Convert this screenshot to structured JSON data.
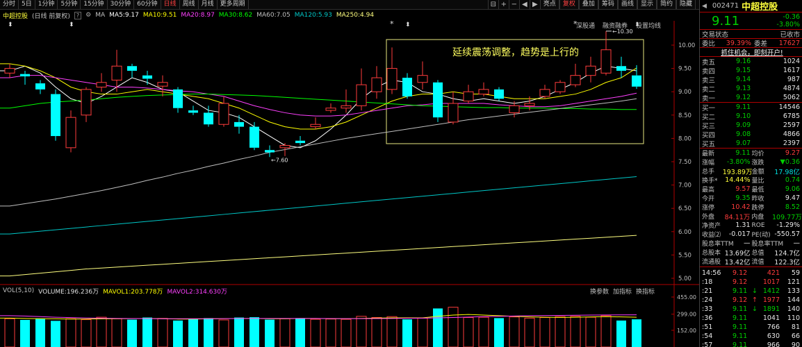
{
  "toolbar": {
    "left": [
      "分时",
      "5日",
      "1分钟",
      "5分钟",
      "15分钟",
      "30分钟",
      "60分钟",
      "日线",
      "周线",
      "月线",
      "更多周期"
    ],
    "active": "日线",
    "right": [
      "亮点",
      "复权",
      "叠加",
      "筹码",
      "画线",
      "显示",
      "简约",
      "隐藏"
    ],
    "active_right": "复权"
  },
  "info": {
    "name": "中超控股",
    "mode": "(日线 前复权)",
    "ma_label": "MA",
    "ma": [
      {
        "text": "MA5:9.17",
        "color": "#ffffff"
      },
      {
        "text": "MA10:9.51",
        "color": "#ffff00"
      },
      {
        "text": "MA20:8.97",
        "color": "#ff40ff"
      },
      {
        "text": "MA30:8.62",
        "color": "#00ff00"
      },
      {
        "text": "MA60:7.05",
        "color": "#c0c0c0"
      },
      {
        "text": "MA120:5.93",
        "color": "#00c8c8"
      },
      {
        "text": "MA250:4.94",
        "color": "#ffff80"
      }
    ],
    "sub_links": [
      "深股通",
      "融资融券",
      "设置均线"
    ]
  },
  "annotation": "延续震荡调整，趋势是上行的",
  "markers": {
    "high": "10.30",
    "low": "7.60",
    "star": "*"
  },
  "vol": {
    "label": "VOL(5,10)",
    "items": [
      {
        "text": "VOLUME:196.236万",
        "color": "#e0e0e0"
      },
      {
        "text": "MAVOL1:203.778万",
        "color": "#ffff00"
      },
      {
        "text": "MAVOL2:314.630万",
        "color": "#ff40ff"
      }
    ],
    "tools": [
      "换参数",
      "加指标",
      "换指标"
    ]
  },
  "chart_data": {
    "type": "candlestick",
    "y_ticks": [
      "10.00",
      "9.50",
      "9.00",
      "8.50",
      "8.00",
      "7.50",
      "7.00",
      "6.50",
      "6.00",
      "5.50",
      "5.00"
    ],
    "vol_ticks": [
      "455.00",
      "299.00",
      "152.00"
    ],
    "candles": [
      {
        "o": 9.4,
        "c": 9.5,
        "h": 9.6,
        "l": 9.3
      },
      {
        "o": 9.38,
        "c": 9.33,
        "h": 9.45,
        "l": 9.15
      },
      {
        "o": 9.18,
        "c": 9.05,
        "h": 9.25,
        "l": 8.95
      },
      {
        "o": 8.95,
        "c": 8.05,
        "h": 9.05,
        "l": 7.95
      },
      {
        "o": 7.8,
        "c": 8.45,
        "h": 8.6,
        "l": 7.7
      },
      {
        "o": 8.5,
        "c": 9.05,
        "h": 9.1,
        "l": 8.35
      },
      {
        "o": 9.1,
        "c": 9.2,
        "h": 9.4,
        "l": 9.0
      },
      {
        "o": 9.25,
        "c": 9.55,
        "h": 9.9,
        "l": 9.0
      },
      {
        "o": 9.55,
        "c": 9.45,
        "h": 9.6,
        "l": 9.3
      },
      {
        "o": 9.35,
        "c": 9.28,
        "h": 9.45,
        "l": 9.15
      },
      {
        "o": 9.12,
        "c": 9.2,
        "h": 9.35,
        "l": 8.9
      },
      {
        "o": 9.05,
        "c": 8.65,
        "h": 9.1,
        "l": 8.55
      },
      {
        "o": 8.6,
        "c": 8.55,
        "h": 8.7,
        "l": 8.5
      },
      {
        "o": 8.55,
        "c": 8.3,
        "h": 8.7,
        "l": 8.25
      },
      {
        "o": 8.3,
        "c": 8.75,
        "h": 8.9,
        "l": 8.25
      },
      {
        "o": 8.35,
        "c": 8.25,
        "h": 8.5,
        "l": 8.1
      },
      {
        "o": 8.25,
        "c": 7.8,
        "h": 8.35,
        "l": 7.75
      },
      {
        "o": 7.75,
        "c": 7.7,
        "h": 7.85,
        "l": 7.6
      },
      {
        "o": 7.8,
        "c": 7.85,
        "h": 7.9,
        "l": 7.62
      },
      {
        "o": 7.95,
        "c": 7.9,
        "h": 8.05,
        "l": 7.85
      },
      {
        "o": 8.25,
        "c": 8.3,
        "h": 8.45,
        "l": 8.2
      },
      {
        "o": 8.6,
        "c": 8.65,
        "h": 8.75,
        "l": 8.55
      },
      {
        "o": 8.65,
        "c": 8.7,
        "h": 9.05,
        "l": 8.55
      },
      {
        "o": 8.7,
        "c": 9.15,
        "h": 9.5,
        "l": 8.6
      },
      {
        "o": 9.0,
        "c": 9.3,
        "h": 9.55,
        "l": 8.85
      },
      {
        "o": 9.05,
        "c": 9.5,
        "h": 9.95,
        "l": 8.95
      },
      {
        "o": 9.3,
        "c": 8.9,
        "h": 9.4,
        "l": 8.85
      },
      {
        "o": 9.2,
        "c": 9.35,
        "h": 9.65,
        "l": 9.05
      },
      {
        "o": 9.2,
        "c": 8.45,
        "h": 9.25,
        "l": 8.35
      },
      {
        "o": 8.35,
        "c": 8.75,
        "h": 9.0,
        "l": 8.3
      },
      {
        "o": 8.8,
        "c": 9.0,
        "h": 9.15,
        "l": 8.75
      },
      {
        "o": 8.95,
        "c": 9.05,
        "h": 9.2,
        "l": 8.9
      },
      {
        "o": 9.05,
        "c": 8.85,
        "h": 9.1,
        "l": 8.8
      },
      {
        "o": 8.55,
        "c": 8.7,
        "h": 8.8,
        "l": 8.45
      },
      {
        "o": 8.7,
        "c": 8.75,
        "h": 8.9,
        "l": 8.6
      },
      {
        "o": 8.9,
        "c": 9.05,
        "h": 9.15,
        "l": 8.85
      },
      {
        "o": 9.0,
        "c": 9.2,
        "h": 9.25,
        "l": 8.95
      },
      {
        "o": 9.15,
        "c": 9.35,
        "h": 9.6,
        "l": 9.1
      },
      {
        "o": 9.35,
        "c": 9.55,
        "h": 9.75,
        "l": 9.2
      },
      {
        "o": 9.4,
        "c": 9.9,
        "h": 10.3,
        "l": 9.35
      },
      {
        "o": 9.55,
        "c": 9.45,
        "h": 9.75,
        "l": 9.3
      },
      {
        "o": 9.35,
        "c": 9.11,
        "h": 9.57,
        "l": 9.06
      }
    ],
    "volumes": [
      250,
      230,
      255,
      215,
      250,
      235,
      275,
      250,
      235,
      270,
      255,
      220,
      250,
      260,
      230,
      270,
      275,
      235,
      250,
      260,
      240,
      245,
      240,
      290,
      270,
      285,
      240,
      260,
      420,
      440,
      270,
      275,
      260,
      280,
      260,
      270,
      285,
      290,
      275,
      300,
      220,
      240
    ],
    "ma_lines": [
      {
        "name": "MA5",
        "color": "#ffffff",
        "pts": [
          9.45,
          9.55,
          9.4,
          9.1,
          8.85,
          8.75,
          8.9,
          9.1,
          9.3,
          9.2,
          9.05,
          9.0,
          8.8,
          8.6,
          8.55,
          8.45,
          8.25,
          8.05,
          7.85,
          7.8,
          7.95,
          8.2,
          8.5,
          8.85,
          9.1,
          9.25,
          9.2,
          9.0,
          8.95,
          8.85,
          8.8,
          8.85,
          8.8,
          8.75,
          8.8,
          8.9,
          9.05,
          9.2,
          9.4,
          9.55,
          9.5,
          9.45
        ]
      },
      {
        "name": "MA10",
        "color": "#ffff00",
        "pts": [
          9.6,
          9.55,
          9.45,
          9.3,
          9.1,
          9.0,
          8.95,
          8.95,
          9.0,
          9.05,
          9.0,
          8.95,
          8.9,
          8.85,
          8.75,
          8.65,
          8.5,
          8.35,
          8.25,
          8.2,
          8.2,
          8.25,
          8.35,
          8.5,
          8.65,
          8.8,
          8.9,
          8.95,
          8.95,
          9.0,
          8.95,
          8.95,
          8.9,
          8.85,
          8.85,
          8.85,
          8.9,
          8.95,
          9.05,
          9.2,
          9.3,
          9.51
        ]
      },
      {
        "name": "MA20",
        "color": "#ff40ff",
        "pts": [
          9.3,
          9.35,
          9.35,
          9.3,
          9.25,
          9.2,
          9.15,
          9.1,
          9.1,
          9.08,
          9.05,
          9.02,
          9.0,
          8.95,
          8.9,
          8.8,
          8.7,
          8.62,
          8.55,
          8.5,
          8.48,
          8.48,
          8.5,
          8.55,
          8.6,
          8.65,
          8.7,
          8.72,
          8.75,
          8.75,
          8.75,
          8.75,
          8.72,
          8.7,
          8.68,
          8.68,
          8.7,
          8.75,
          8.8,
          8.85,
          8.9,
          8.97
        ]
      },
      {
        "name": "MA30",
        "color": "#00ff00",
        "pts": [
          8.65,
          8.7,
          8.75,
          8.78,
          8.8,
          8.82,
          8.85,
          8.88,
          8.9,
          8.92,
          8.93,
          8.94,
          8.95,
          8.95,
          8.94,
          8.93,
          8.92,
          8.9,
          8.88,
          8.86,
          8.84,
          8.82,
          8.8,
          8.78,
          8.76,
          8.74,
          8.72,
          8.7,
          8.69,
          8.68,
          8.67,
          8.66,
          8.66,
          8.65,
          8.65,
          8.65,
          8.64,
          8.64,
          8.63,
          8.63,
          8.62,
          8.62
        ]
      },
      {
        "name": "MA60",
        "color": "#c0c0c0",
        "pts": [
          6.55,
          6.6,
          6.65,
          6.7,
          6.76,
          6.82,
          6.88,
          6.95,
          7.02,
          7.1,
          7.17,
          7.25,
          7.32,
          7.4,
          7.47,
          7.55,
          7.62,
          7.7,
          7.76,
          7.82,
          7.88,
          7.94,
          8.0,
          8.05,
          8.1,
          8.15,
          8.2,
          8.25,
          8.3,
          8.35,
          8.4,
          8.44,
          8.48,
          8.52,
          8.56,
          8.6,
          8.64,
          8.68,
          8.72,
          8.76,
          8.8,
          8.85
        ]
      },
      {
        "name": "MA120",
        "color": "#00c8c8",
        "pts": [
          5.95,
          5.98,
          6.01,
          6.04,
          6.07,
          6.1,
          6.13,
          6.16,
          6.19,
          6.22,
          6.25,
          6.28,
          6.31,
          6.34,
          6.37,
          6.4,
          6.43,
          6.46,
          6.49,
          6.52,
          6.55,
          6.58,
          6.61,
          6.64,
          6.67,
          6.7,
          6.73,
          6.76,
          6.79,
          6.82,
          6.85,
          6.88,
          6.91,
          6.94,
          6.97,
          7.0,
          7.03,
          7.06,
          7.09,
          7.12,
          7.15,
          7.18
        ]
      },
      {
        "name": "MA250",
        "color": "#ffff80",
        "pts": [
          5.05,
          5.08,
          5.11,
          5.14,
          5.17,
          5.2,
          5.22,
          5.24,
          5.26,
          5.28,
          5.3,
          5.32,
          5.34,
          5.36,
          5.38,
          5.4,
          5.42,
          5.44,
          5.46,
          5.48,
          5.5,
          5.52,
          5.54,
          5.56,
          5.58,
          5.6,
          5.62,
          5.64,
          5.66,
          5.68,
          5.7,
          5.72,
          5.74,
          5.76,
          5.78,
          5.8,
          5.82,
          5.84,
          5.86,
          5.88,
          5.9,
          5.92
        ]
      }
    ],
    "mavol1": [
      260,
      255,
      250,
      248,
      245,
      245,
      248,
      250,
      252,
      255,
      250,
      245,
      245,
      248,
      252,
      255,
      255,
      250,
      250,
      255,
      255,
      250,
      250,
      255,
      260,
      265,
      265,
      265,
      290,
      310,
      320,
      310,
      300,
      290,
      280,
      275,
      272,
      275,
      280,
      285,
      280,
      275
    ],
    "mavol2": [
      300,
      295,
      285,
      275,
      268,
      262,
      258,
      255,
      253,
      252,
      250,
      250,
      250,
      250,
      252,
      253,
      255,
      255,
      255,
      255,
      254,
      253,
      252,
      252,
      253,
      255,
      258,
      260,
      265,
      270,
      278,
      285,
      290,
      295,
      300,
      302,
      305,
      308,
      310,
      312,
      313,
      315
    ]
  },
  "panel": {
    "code": "002471",
    "name": "中超控股",
    "price": "9.11",
    "change": "-0.36",
    "change_pct": "-3.80%",
    "status_label": "交易状态",
    "status": "已收市",
    "wb_label": "委比",
    "wb": "39.39%",
    "wc_label": "委差",
    "wc": "17627",
    "promo": "抓住机会，即刻开户!",
    "sells": [
      {
        "label": "卖五",
        "price": "9.16",
        "vol": "1024"
      },
      {
        "label": "卖四",
        "price": "9.15",
        "vol": "1617"
      },
      {
        "label": "卖三",
        "price": "9.14",
        "vol": "987"
      },
      {
        "label": "卖二",
        "price": "9.13",
        "vol": "4874"
      },
      {
        "label": "卖一",
        "price": "9.12",
        "vol": "5062"
      }
    ],
    "buys": [
      {
        "label": "买一",
        "price": "9.11",
        "vol": "14546"
      },
      {
        "label": "买二",
        "price": "9.10",
        "vol": "6785"
      },
      {
        "label": "买三",
        "price": "9.09",
        "vol": "2597"
      },
      {
        "label": "买四",
        "price": "9.08",
        "vol": "4866"
      },
      {
        "label": "买五",
        "price": "9.07",
        "vol": "2397"
      }
    ],
    "stats": [
      [
        {
          "l": "最新",
          "v": "9.11",
          "c": "grn"
        },
        {
          "l": "均价",
          "v": "9.27",
          "c": "red"
        }
      ],
      [
        {
          "l": "涨幅",
          "v": "-3.80%",
          "c": "grn"
        },
        {
          "l": "涨跌",
          "v": "▼0.36",
          "c": "grn"
        }
      ],
      [
        {
          "l": "总手",
          "v": "193.89万",
          "c": "yel"
        },
        {
          "l": "金额",
          "v": "17.98亿",
          "c": "cyan"
        }
      ],
      [
        {
          "l": "换手*",
          "v": "14.44%",
          "c": "yel"
        },
        {
          "l": "量比",
          "v": "0.74",
          "c": "grn"
        }
      ],
      [
        {
          "l": "最高",
          "v": "9.57",
          "c": "red"
        },
        {
          "l": "最低",
          "v": "9.06",
          "c": "grn"
        }
      ],
      [
        {
          "l": "今开",
          "v": "9.35",
          "c": "grn"
        },
        {
          "l": "昨收",
          "v": "9.47",
          "c": "wht"
        }
      ],
      [
        {
          "l": "涨停",
          "v": "10.42",
          "c": "red"
        },
        {
          "l": "跌停",
          "v": "8.52",
          "c": "grn"
        }
      ],
      [
        {
          "l": "外盘",
          "v": "84.11万",
          "c": "red"
        },
        {
          "l": "内盘",
          "v": "109.77万",
          "c": "grn"
        }
      ],
      [
        {
          "l": "净资产",
          "v": "1.31",
          "c": "wht"
        },
        {
          "l": "ROE",
          "v": "-1.29%",
          "c": "wht"
        }
      ],
      [
        {
          "l": "收益⑵",
          "v": "-0.017",
          "c": "wht"
        },
        {
          "l": "PE(动)",
          "v": "-550.57",
          "c": "wht"
        }
      ],
      [
        {
          "l": "股息率TTM",
          "v": "—",
          "c": "wht"
        },
        {
          "l": "股息率TTM",
          "v": "—",
          "c": "wht"
        }
      ],
      [
        {
          "l": "总股本",
          "v": "13.69亿",
          "c": "wht"
        },
        {
          "l": "总值",
          "v": "124.7亿",
          "c": "wht"
        }
      ],
      [
        {
          "l": "流通股",
          "v": "13.42亿",
          "c": "wht"
        },
        {
          "l": "流值",
          "v": "122.3亿",
          "c": "wht"
        }
      ]
    ],
    "ticks": [
      {
        "t": "14:56",
        "p": "9.12",
        "pc": "red",
        "a": "",
        "v": "421",
        "vc": "red",
        "n": "59"
      },
      {
        "t": ":18",
        "p": "9.12",
        "pc": "red",
        "a": "",
        "v": "1017",
        "vc": "red",
        "n": "121"
      },
      {
        "t": ":21",
        "p": "9.11",
        "pc": "grn",
        "a": "↓",
        "v": "1412",
        "vc": "grn",
        "n": "133"
      },
      {
        "t": ":24",
        "p": "9.12",
        "pc": "red",
        "a": "↑",
        "v": "1977",
        "vc": "red",
        "n": "144"
      },
      {
        "t": ":33",
        "p": "9.11",
        "pc": "grn",
        "a": "↓",
        "v": "1891",
        "vc": "grn",
        "n": "140"
      },
      {
        "t": ":36",
        "p": "9.11",
        "pc": "grn",
        "a": "",
        "v": "1041",
        "vc": "wht",
        "n": "110"
      },
      {
        "t": ":51",
        "p": "9.11",
        "pc": "grn",
        "a": "",
        "v": "766",
        "vc": "wht",
        "n": "81"
      },
      {
        "t": ":54",
        "p": "9.11",
        "pc": "grn",
        "a": "",
        "v": "630",
        "vc": "wht",
        "n": "66"
      },
      {
        "t": ":57",
        "p": "9.11",
        "pc": "grn",
        "a": "",
        "v": "966",
        "vc": "wht",
        "n": "90"
      }
    ]
  }
}
